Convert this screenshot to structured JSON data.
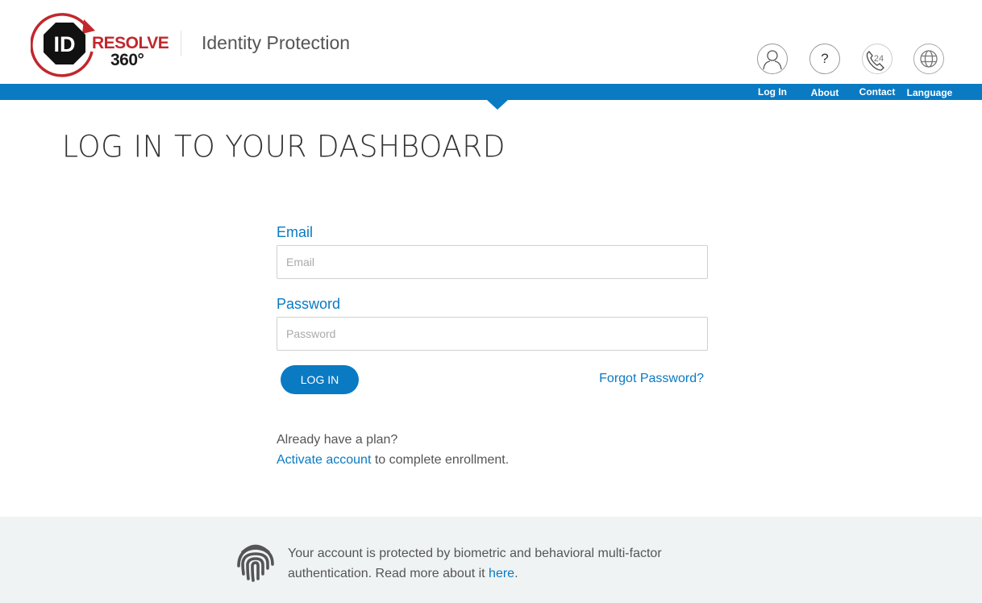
{
  "header": {
    "logo": {
      "badge_text": "ID",
      "brand_word": "RESOLVE",
      "brand_number": "360°"
    },
    "site_title": "Identity Protection",
    "nav": [
      {
        "label": "Log In",
        "icon": "user-icon"
      },
      {
        "label": "About",
        "icon": "question-icon",
        "glyph": "?"
      },
      {
        "label": "Contact",
        "icon": "phone-24-icon",
        "glyph": "24"
      },
      {
        "label": "Language",
        "icon": "globe-icon"
      }
    ]
  },
  "page": {
    "title": "LOG IN TO YOUR DASHBOARD"
  },
  "form": {
    "email": {
      "label": "Email",
      "placeholder": "Email",
      "value": ""
    },
    "password": {
      "label": "Password",
      "placeholder": "Password",
      "value": ""
    },
    "login_button": "LOG IN",
    "forgot_link": "Forgot Password?",
    "plan_question": "Already have a plan?",
    "activate_link": "Activate account",
    "activate_suffix": " to complete enrollment."
  },
  "footer": {
    "icon": "fingerprint-icon",
    "text": "Your account is protected by biometric and behavioral multi-factor authentication. Read more about it ",
    "link": "here",
    "text_end": "."
  },
  "colors": {
    "brand_blue": "#0a7ac3",
    "brand_red": "#c1272d",
    "footer_bg": "#f0f3f4"
  }
}
